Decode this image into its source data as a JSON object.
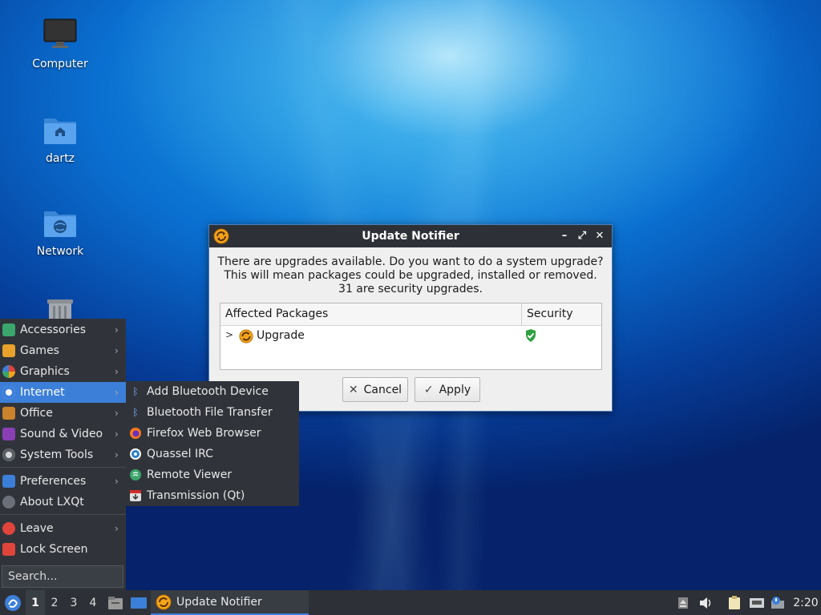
{
  "desktop": {
    "icons": [
      {
        "label": "Computer"
      },
      {
        "label": "dartz"
      },
      {
        "label": "Network"
      }
    ]
  },
  "dialog": {
    "title": "Update Notifier",
    "message_lines": [
      "There are upgrades available. Do you want to do a system upgrade?",
      "This will mean packages could be upgraded, installed or removed.",
      "31 are security upgrades."
    ],
    "table": {
      "headers": [
        "Affected Packages",
        "Security"
      ],
      "rows": [
        {
          "name": "Upgrade",
          "security": "shield-check-icon"
        }
      ]
    },
    "buttons": {
      "cancel": "Cancel",
      "apply": "Apply"
    }
  },
  "menu": {
    "items": [
      {
        "label": "Accessories",
        "icon": "accessories-icon",
        "color": "#3aa66b"
      },
      {
        "label": "Games",
        "icon": "games-icon",
        "color": "#e8a12a"
      },
      {
        "label": "Graphics",
        "icon": "graphics-icon",
        "color": "#d9468f"
      },
      {
        "label": "Internet",
        "icon": "internet-icon",
        "color": "#ffffff"
      },
      {
        "label": "Office",
        "icon": "office-icon",
        "color": "#c9832b"
      },
      {
        "label": "Sound & Video",
        "icon": "sound-video-icon",
        "color": "#8a3fb5"
      },
      {
        "label": "System Tools",
        "icon": "system-tools-icon",
        "color": "#5a5f66"
      },
      {
        "label": "Preferences",
        "icon": "preferences-icon",
        "color": "#3c7fd8"
      },
      {
        "label": "About LXQt",
        "icon": "about-icon",
        "color": "#6c7078"
      },
      {
        "label": "Leave",
        "icon": "leave-icon",
        "color": "#e0443a"
      },
      {
        "label": "Lock Screen",
        "icon": "lock-icon",
        "color": "#e0443a"
      }
    ],
    "search_placeholder": "Search..."
  },
  "submenu": {
    "items": [
      {
        "label": "Add Bluetooth Device",
        "icon": "bluetooth-icon"
      },
      {
        "label": "Bluetooth File Transfer",
        "icon": "bluetooth-icon"
      },
      {
        "label": "Firefox Web Browser",
        "icon": "firefox-icon"
      },
      {
        "label": "Quassel IRC",
        "icon": "quassel-icon"
      },
      {
        "label": "Remote Viewer",
        "icon": "remote-viewer-icon"
      },
      {
        "label": "Transmission (Qt)",
        "icon": "transmission-icon"
      }
    ]
  },
  "taskbar": {
    "workspaces": [
      "1",
      "2",
      "3",
      "4"
    ],
    "active_workspace": "1",
    "task": "Update Notifier",
    "clock": "2:20"
  },
  "colors": {
    "accent": "#3c7fd8",
    "panel": "#2d3036",
    "menu_bg": "#30343a"
  }
}
